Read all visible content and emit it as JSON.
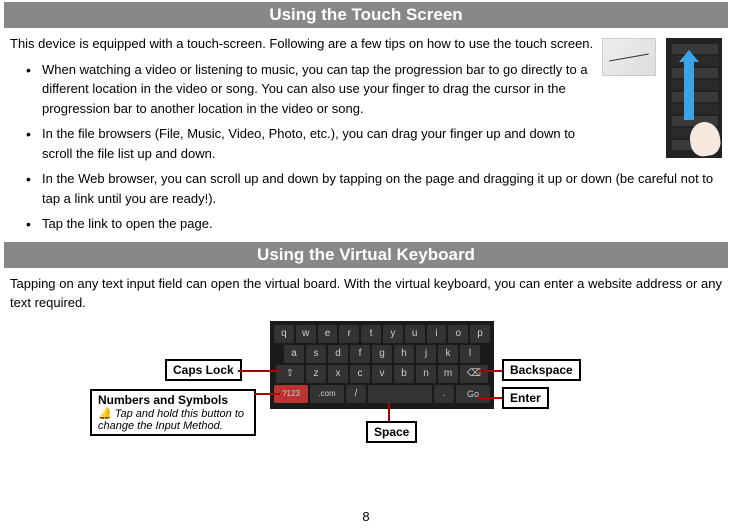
{
  "sections": {
    "touch": {
      "title": "Using the Touch Screen",
      "intro": "This device is equipped with a touch-screen. Following are a few tips on how to use the touch screen.",
      "bullets": [
        "When watching a video or listening to music, you can tap the progression bar to go directly to a different location in the video or song. You can also use your finger to drag the cursor in the progression bar to another location in the video or song.",
        "In the file browsers (File, Music, Video, Photo, etc.), you can drag your finger up and down to scroll the file list up and down.",
        "In the Web browser, you can scroll up and down by tapping on the page and dragging it up or down (be careful not to tap a link until you are ready!).",
        "Tap the link to open the page."
      ]
    },
    "keyboard": {
      "title": "Using the Virtual Keyboard",
      "intro": "Tapping on any text input field can open the virtual board. With the virtual keyboard, you can enter a website address or any text required.",
      "callouts": {
        "caps": "Caps Lock",
        "numsym": "Numbers and Symbols",
        "numsym_sub": "Tap and hold this button to change the Input Method.",
        "backspace": "Backspace",
        "enter": "Enter",
        "space": "Space"
      },
      "keys": {
        "row1": [
          "q",
          "w",
          "e",
          "r",
          "t",
          "y",
          "u",
          "i",
          "o",
          "p"
        ],
        "row2": [
          "a",
          "s",
          "d",
          "f",
          "g",
          "h",
          "j",
          "k",
          "l"
        ],
        "row3_mid": [
          "z",
          "x",
          "c",
          "v",
          "b",
          "n",
          "m"
        ],
        "row4": {
          "numkey": "?123",
          "com": ".com",
          "slash": "/",
          "dot": ".",
          "go": "Go"
        }
      }
    }
  },
  "page_number": "8"
}
